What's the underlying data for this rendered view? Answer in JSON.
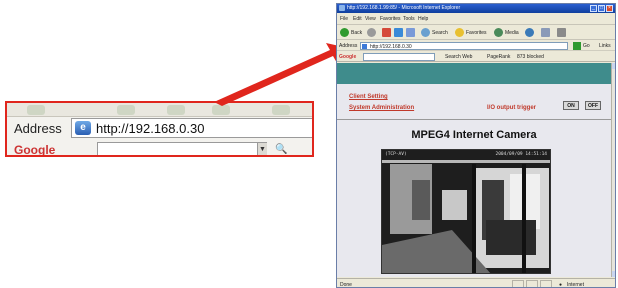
{
  "zoom": {
    "address_label": "Address",
    "url": "http://192.168.0.30",
    "google_label": "Google"
  },
  "browser": {
    "title": "http://192.168.1.99:85/ - Microsoft Internet Explorer",
    "menu": [
      "File",
      "Edit",
      "View",
      "Favorites",
      "Tools",
      "Help"
    ],
    "toolbar": {
      "back": "Back",
      "search": "Search",
      "favorites": "Favorites",
      "media": "Media"
    },
    "address_label": "Address",
    "url": "http://192.168.0.30",
    "go": "Go",
    "links": "Links",
    "google": {
      "label": "Google",
      "search_web": "Search Web",
      "pagerank": "PageRank",
      "blocked": "873 blocked"
    },
    "status": {
      "left": "Done",
      "zone": "Internet"
    }
  },
  "page": {
    "client_setting": "Client Setting",
    "system_admin": "System Administration",
    "io_trigger": "I/O output trigger",
    "on_label": "ON",
    "off_label": "OFF",
    "camera_title": "MPEG4 Internet Camera",
    "osd_left": "(TCP-AV)",
    "osd_right": "2004/09/09 14:51:14"
  },
  "colors": {
    "callout_border": "#e0261d",
    "arrow": "#e0261d",
    "teal_band": "#3f8c8c",
    "link": "#c0392b"
  }
}
